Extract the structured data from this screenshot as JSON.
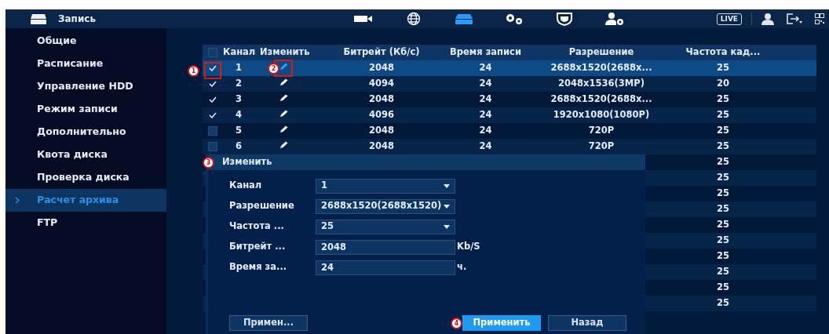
{
  "header": {
    "title": "Запись",
    "tabs": [
      {
        "kind": "camera",
        "selected": false
      },
      {
        "kind": "globe",
        "selected": false
      },
      {
        "kind": "hdd",
        "selected": true
      },
      {
        "kind": "gears",
        "selected": false
      },
      {
        "kind": "shield",
        "selected": false
      },
      {
        "kind": "usergear",
        "selected": false
      }
    ],
    "live_button": "LIVE"
  },
  "sidebar": {
    "items": [
      {
        "label": "Общие",
        "selected": false
      },
      {
        "label": "Расписание",
        "selected": false
      },
      {
        "label": "Управление HDD",
        "selected": false
      },
      {
        "label": "Режим записи",
        "selected": false
      },
      {
        "label": "Дополнительно",
        "selected": false
      },
      {
        "label": "Квота диска",
        "selected": false
      },
      {
        "label": "Проверка диска",
        "selected": false
      },
      {
        "label": "Расчет архива",
        "selected": true
      },
      {
        "label": "FTP",
        "selected": false
      }
    ]
  },
  "table": {
    "all_checked": false,
    "columns": [
      "Канал",
      "Изменить",
      "Битрейт (Кб/с)",
      "Время записи",
      "Разрешение",
      "Частота кад..."
    ],
    "rows": [
      {
        "selected": true,
        "checked": true,
        "channel": "1",
        "bitrate": "2048",
        "record_time": "24",
        "resolution": "2688x1520(2688x...",
        "frame_rate": "25",
        "check_marker": "1",
        "edit_marker": "2"
      },
      {
        "selected": false,
        "checked": true,
        "channel": "2",
        "bitrate": "4094",
        "record_time": "24",
        "resolution": "2048x1536(3MP)",
        "frame_rate": "20"
      },
      {
        "selected": false,
        "checked": true,
        "channel": "3",
        "bitrate": "2048",
        "record_time": "24",
        "resolution": "2688x1520(2688x...",
        "frame_rate": "25"
      },
      {
        "selected": false,
        "checked": true,
        "channel": "4",
        "bitrate": "4096",
        "record_time": "24",
        "resolution": "1920x1080(1080P)",
        "frame_rate": "25"
      },
      {
        "selected": false,
        "checked": false,
        "channel": "5",
        "bitrate": "2048",
        "record_time": "24",
        "resolution": "720P",
        "frame_rate": "25"
      },
      {
        "selected": false,
        "checked": false,
        "channel": "6",
        "bitrate": "2048",
        "record_time": "24",
        "resolution": "720P",
        "frame_rate": "25"
      },
      {
        "frame_rate": "25"
      },
      {
        "frame_rate": "25"
      },
      {
        "frame_rate": "25"
      },
      {
        "frame_rate": "25"
      },
      {
        "frame_rate": "25"
      },
      {
        "frame_rate": "25"
      },
      {
        "frame_rate": "25"
      },
      {
        "frame_rate": "25"
      },
      {
        "frame_rate": "25"
      },
      {
        "frame_rate": "25"
      }
    ]
  },
  "dialog": {
    "title": "Изменить",
    "title_marker": "3",
    "fields": [
      {
        "kind": "select",
        "label": "Канал",
        "value": "1"
      },
      {
        "kind": "select",
        "label": "Разрешение",
        "value": "2688x1520(2688x1520)"
      },
      {
        "kind": "select",
        "label": "Частота ...",
        "value": "25"
      },
      {
        "kind": "input",
        "label": "Битрейт ...",
        "value": "2048",
        "unit": "Kb/S"
      },
      {
        "kind": "input",
        "label": "Время за...",
        "value": "24",
        "unit": "ч."
      }
    ],
    "buttons": [
      {
        "label": "Примен...",
        "primary": false
      },
      {
        "label": "Применить",
        "primary": true,
        "marker": "4"
      },
      {
        "label": "Назад",
        "primary": false
      }
    ]
  }
}
